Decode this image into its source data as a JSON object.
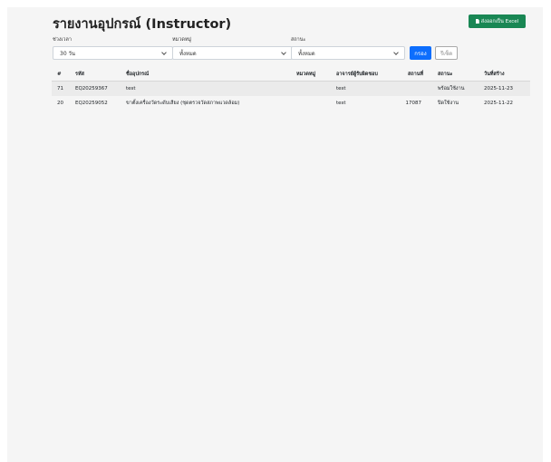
{
  "header": {
    "title": "รายงานอุปกรณ์ (Instructor)",
    "export_label": "ส่งออกเป็น Excel"
  },
  "filters": {
    "period": {
      "label": "ช่วงเวลา",
      "value": "30 วัน"
    },
    "category": {
      "label": "หมวดหมู่",
      "value": "ทั้งหมด"
    },
    "status": {
      "label": "สถานะ",
      "value": "ทั้งหมด"
    },
    "filter_button": "กรอง",
    "reset_button": "รีเซ็ต"
  },
  "table": {
    "columns": [
      "#",
      "รหัส",
      "ชื่ออุปกรณ์",
      "หมวดหมู่",
      "อาจารย์ผู้รับผิดชอบ",
      "สถานที่",
      "สถานะ",
      "วันที่สร้าง"
    ],
    "rows": [
      [
        "71",
        "EQ20259367",
        "test",
        "",
        "test",
        "",
        "พร้อมใช้งาน",
        "2025-11-23"
      ],
      [
        "20",
        "EQ20259052",
        "ขาตั้งเครื่องวัดระดับเสียง (ชุดตรวจวัดสภาพแวดล้อม)",
        "",
        "test",
        "17087",
        "ปิดใช้งาน",
        "2025-11-22"
      ]
    ]
  }
}
